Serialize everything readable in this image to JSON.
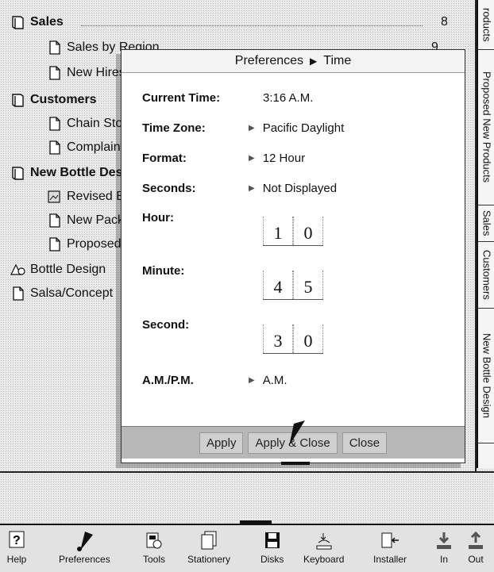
{
  "notebook": {
    "rows": [
      {
        "label": "Sales",
        "page": "8"
      },
      {
        "label": "Sales by Region",
        "page": "9"
      },
      {
        "label": "New Hires"
      },
      {
        "label": "Customers"
      },
      {
        "label": "Chain Stores"
      },
      {
        "label": "Complaints"
      },
      {
        "label": "New Bottle Design"
      },
      {
        "label": "Revised Bottle"
      },
      {
        "label": "New Packaging"
      },
      {
        "label": "Proposed Bottle"
      },
      {
        "label": "Bottle Design"
      },
      {
        "label": "Salsa/Concept"
      }
    ]
  },
  "tabs": [
    "roducts",
    "Proposed New Products",
    "Sales",
    "Customers",
    "New Bottle Design"
  ],
  "dialog": {
    "title_parent": "Preferences",
    "title_child": "Time",
    "current_time_label": "Current Time:",
    "current_time_value": "3:16 A.M.",
    "time_zone_label": "Time Zone:",
    "time_zone_value": "Pacific Daylight",
    "format_label": "Format:",
    "format_value": "12 Hour",
    "seconds_label": "Seconds:",
    "seconds_value": "Not Displayed",
    "hour_label": "Hour:",
    "hour_digits": [
      "1",
      "0"
    ],
    "minute_label": "Minute:",
    "minute_digits": [
      "4",
      "5"
    ],
    "second_label": "Second:",
    "second_digits": [
      "3",
      "0"
    ],
    "ampm_label": "A.M./P.M.",
    "ampm_value": "A.M.",
    "buttons": {
      "apply": "Apply",
      "apply_close": "Apply & Close",
      "close": "Close"
    }
  },
  "toolbar": {
    "items": [
      {
        "label": "Help",
        "icon": "help-icon"
      },
      {
        "label": "Preferences",
        "icon": "preferences-icon"
      },
      {
        "label": "Tools",
        "icon": "tools-icon"
      },
      {
        "label": "Stationery",
        "icon": "stationery-icon"
      },
      {
        "label": "Disks",
        "icon": "disks-icon"
      },
      {
        "label": "Keyboard",
        "icon": "keyboard-icon"
      },
      {
        "label": "Installer",
        "icon": "installer-icon"
      },
      {
        "label": "In",
        "icon": "in-tray-icon"
      },
      {
        "label": "Out",
        "icon": "out-tray-icon"
      }
    ]
  }
}
